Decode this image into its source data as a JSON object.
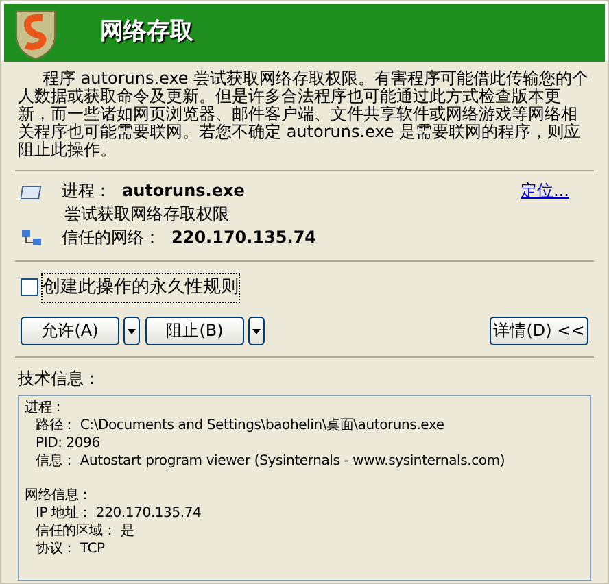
{
  "window": {
    "title": "网络存取"
  },
  "description": "程序 autoruns.exe 尝试获取网络存取权限。有害程序可能借此传输您的个人数据或获取命令及更新。但是许多合法程序也可能通过此方式检查版本更新，而一些诸如网页浏览器、邮件客户端、文件共享软件或网络游戏等网络相关程序也可能需要联网。若您不确定 autoruns.exe 是需要联网的程序，则应阻止此操作。",
  "process": {
    "label": "进程：",
    "value": "autoruns.exe",
    "link": "定位...",
    "action": "尝试获取网络存取权限"
  },
  "network": {
    "label": "信任的网络：",
    "value": "220.170.135.74"
  },
  "checkbox": {
    "label": "创建此操作的永久性规则",
    "checked": false
  },
  "buttons": [
    {
      "label": "允许(A)",
      "kind": "split"
    },
    {
      "label": "阻止(B)",
      "kind": "split"
    },
    {
      "label": "详情(D) <<",
      "kind": "plain"
    }
  ],
  "tech_info": {
    "label": "技术信息：",
    "sections": [
      {
        "title": "进程：",
        "lines": [
          "路径： C:\\Documents and Settings\\baohelin\\桌面\\autoruns.exe",
          "PID: 2096",
          "信息： Autostart program viewer (Sysinternals - www.sysinternals.com)"
        ]
      },
      {
        "title": "网络信息：",
        "lines": [
          "IP 地址： 220.170.135.74",
          "信任的区域： 是",
          "协议： TCP"
        ]
      }
    ]
  }
}
